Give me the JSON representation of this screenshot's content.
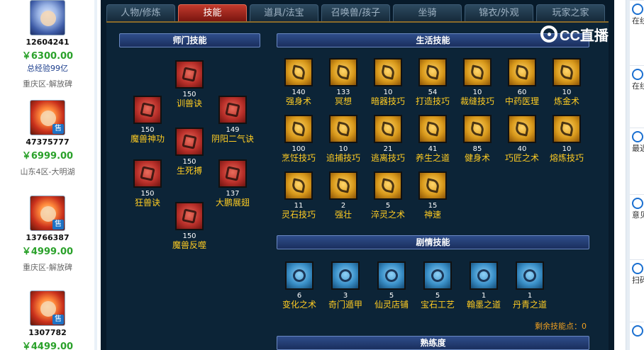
{
  "listings": [
    {
      "id": "12604241",
      "price": "￥6300.00",
      "extra": "总经验99亿",
      "server": "重庆区-解放碑",
      "avatar": "blue"
    },
    {
      "id": "47375777",
      "price": "￥6999.00",
      "extra": "",
      "server": "山东4区-大明湖",
      "avatar": "red"
    },
    {
      "id": "13766387",
      "price": "￥4999.00",
      "extra": "",
      "server": "重庆区-解放碑",
      "avatar": "red"
    },
    {
      "id": "1307782",
      "price": "￥4499.00",
      "extra": "",
      "server": "",
      "avatar": "red"
    }
  ],
  "sell_badge": "售",
  "tabs": [
    "人物/修炼",
    "技能",
    "道具/法宝",
    "召唤兽/孩子",
    "坐骑",
    "锦衣/外观",
    "玩家之家"
  ],
  "active_tab": "技能",
  "sections": {
    "school": "师门技能",
    "life": "生活技能",
    "story": "剧情技能",
    "proficiency": "熟练度"
  },
  "school_skills": [
    {
      "level": "150",
      "name": "训兽诀"
    },
    {
      "level": "150",
      "name": "魔兽神功"
    },
    {
      "level": "149",
      "name": "阴阳二气诀"
    },
    {
      "level": "150",
      "name": "生死搏"
    },
    {
      "level": "150",
      "name": "狂兽诀"
    },
    {
      "level": "137",
      "name": "大鹏展翅"
    },
    {
      "level": "150",
      "name": "魔兽反噬"
    }
  ],
  "life_skills": [
    {
      "level": "140",
      "name": "强身术"
    },
    {
      "level": "133",
      "name": "冥想"
    },
    {
      "level": "10",
      "name": "暗器技巧"
    },
    {
      "level": "54",
      "name": "打造技巧"
    },
    {
      "level": "10",
      "name": "裁缝技巧"
    },
    {
      "level": "60",
      "name": "中药医理"
    },
    {
      "level": "10",
      "name": "炼金术"
    },
    {
      "level": "100",
      "name": "烹饪技巧"
    },
    {
      "level": "10",
      "name": "追捕技巧"
    },
    {
      "level": "21",
      "name": "逃离技巧"
    },
    {
      "level": "41",
      "name": "养生之道"
    },
    {
      "level": "85",
      "name": "健身术"
    },
    {
      "level": "40",
      "name": "巧匠之术"
    },
    {
      "level": "10",
      "name": "熔炼技巧"
    },
    {
      "level": "11",
      "name": "灵石技巧"
    },
    {
      "level": "2",
      "name": "强壮"
    },
    {
      "level": "5",
      "name": "淬灵之术"
    },
    {
      "level": "15",
      "name": "神速"
    }
  ],
  "story_skills": [
    {
      "level": "6",
      "name": "变化之术"
    },
    {
      "level": "3",
      "name": "奇门遁甲"
    },
    {
      "level": "5",
      "name": "仙灵店铺"
    },
    {
      "level": "5",
      "name": "宝石工艺"
    },
    {
      "level": "1",
      "name": "翰墨之道"
    },
    {
      "level": "1",
      "name": "丹青之道"
    }
  ],
  "remaining": "剩余技能点：0",
  "watermark": "CC直播",
  "right_items": [
    "在线精灵",
    "在线客服",
    "最近浏览",
    "意见反馈",
    "扫码下载"
  ]
}
